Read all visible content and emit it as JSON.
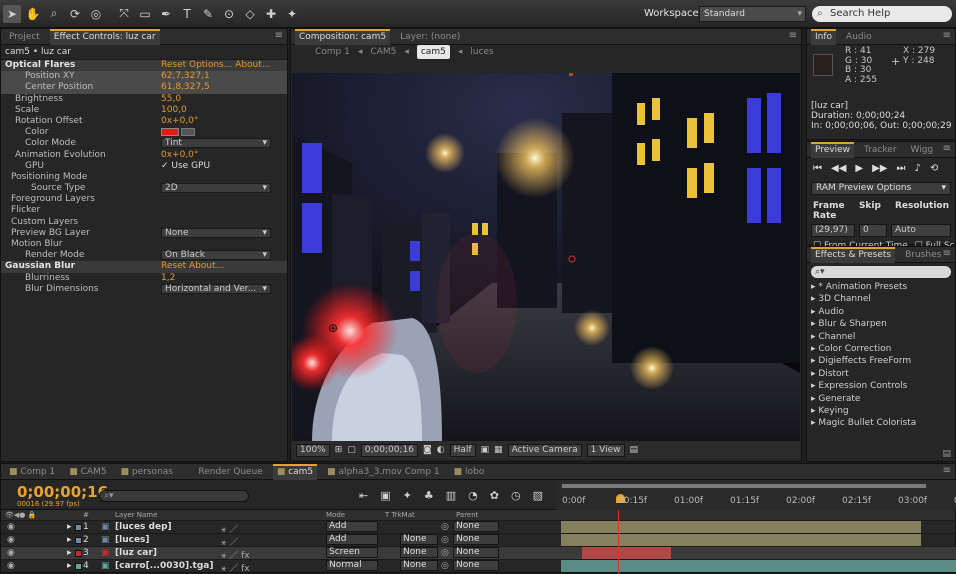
{
  "toolbar": {
    "tools": [
      "selection-tool",
      "hand-tool",
      "zoom-tool",
      "rotation-tool",
      "camera-tool",
      "pan-behind-tool",
      "mask-tool",
      "pen-tool",
      "text-tool",
      "brush-tool",
      "clone-stamp-tool",
      "eraser-tool",
      "roto-brush-tool",
      "puppet-tool"
    ],
    "workspace_label": "Workspace:",
    "workspace_value": "Standard",
    "search_placeholder": "Search Help"
  },
  "effect_controls": {
    "tab_project": "Project",
    "tab_effect": "Effect Controls: luz car",
    "breadcrumb": "cam5 • luz car",
    "rows": [
      {
        "label": "Optical Flares",
        "indent": 4,
        "type": "hdr",
        "val": "Reset  Options...  About..."
      },
      {
        "label": "Position XY",
        "indent": 24,
        "type": "sel",
        "val": "62,7,327,1"
      },
      {
        "label": "Center Position",
        "indent": 24,
        "type": "sel",
        "val": "61,8,327,5"
      },
      {
        "label": "Brightness",
        "indent": 14,
        "val": "55,0"
      },
      {
        "label": "Scale",
        "indent": 14,
        "val": "100,0"
      },
      {
        "label": "Rotation Offset",
        "indent": 14,
        "val": "0x+0,0°"
      },
      {
        "label": "Color",
        "indent": 24,
        "type": "color"
      },
      {
        "label": "Color Mode",
        "indent": 24,
        "type": "select",
        "val": "Tint"
      },
      {
        "label": "Animation Evolution",
        "indent": 14,
        "val": "0x+0,0°"
      },
      {
        "label": "GPU",
        "indent": 24,
        "type": "check",
        "val": "✓ Use GPU"
      },
      {
        "label": "Positioning Mode",
        "indent": 10,
        "type": "group"
      },
      {
        "label": "Source Type",
        "indent": 30,
        "type": "select",
        "val": "2D"
      },
      {
        "label": "Foreground Layers",
        "indent": 10
      },
      {
        "label": "Flicker",
        "indent": 10
      },
      {
        "label": "Custom Layers",
        "indent": 10
      },
      {
        "label": "Preview BG Layer",
        "indent": 10,
        "type": "select",
        "val": "None"
      },
      {
        "label": "Motion Blur",
        "indent": 10
      },
      {
        "label": "Render Mode",
        "indent": 24,
        "type": "select",
        "val": "On Black"
      },
      {
        "label": "Gaussian Blur",
        "indent": 4,
        "type": "hdr2",
        "val": "Reset                About..."
      },
      {
        "label": "Blurriness",
        "indent": 24,
        "val": "1,2"
      },
      {
        "label": "Blur Dimensions",
        "indent": 24,
        "type": "select",
        "val": "Horizontal and Ver..."
      }
    ]
  },
  "composition": {
    "tab_comp": "Composition: cam5",
    "tab_layer": "Layer: (none)",
    "breadcrumbs": [
      "Comp 1",
      "CAM5",
      "cam5",
      "luces"
    ],
    "zoom": "100%",
    "timecode": "0;00;00;16",
    "resolution": "Half",
    "camera": "Active Camera",
    "views": "1 View"
  },
  "info": {
    "tab_info": "Info",
    "tab_audio": "Audio",
    "r": "R : 41",
    "g": "G : 30",
    "b": "B : 30",
    "a": "A : 255",
    "x": "X : 279",
    "y": "Y : 248",
    "layer": "[luz car]",
    "duration": "Duration: 0;00;00;24",
    "inout": "In: 0;00;00;06, Out: 0;00;00;29",
    "swatch_color": "#291e1e"
  },
  "preview": {
    "tab_preview": "Preview",
    "tab_tracker": "Tracker",
    "tab_wiggler": "Wigg",
    "ram_options": "RAM Preview Options",
    "frame_rate_label": "Frame Rate",
    "skip_label": "Skip",
    "resolution_label": "Resolution",
    "frame_rate": "(29,97)",
    "skip": "0",
    "resolution": "Auto",
    "from_current": "From Current Time",
    "full_screen": "Full Scre"
  },
  "effects_presets": {
    "tab_fx": "Effects & Presets",
    "tab_brushes": "Brushes",
    "items": [
      "* Animation Presets",
      "3D Channel",
      "Audio",
      "Blur & Sharpen",
      "Channel",
      "Color Correction",
      "Digieffects FreeForm",
      "Distort",
      "Expression Controls",
      "Generate",
      "Keying",
      "Magic Bullet Colorista"
    ]
  },
  "timeline": {
    "tabs": [
      "Comp 1",
      "CAM5",
      "personas",
      "Render Queue",
      "cam5",
      "alpha3_3.mov Comp 1",
      "lobo"
    ],
    "tab_colors": [
      "#8a8a8a",
      "#8a8a8a",
      "#8a8a8a",
      "",
      "#8a8a8a",
      "#8a8a8a",
      "#8a8a8a"
    ],
    "timecode": "0;00;00;16",
    "fps": "00016 (29.97 fps)",
    "ruler": [
      "0:00f",
      "00:15f",
      "01:00f",
      "01:15f",
      "02:00f",
      "02:15f",
      "03:00f",
      "03:1"
    ],
    "columns": {
      "layer_name": "Layer Name",
      "mode": "Mode",
      "trkmat": "T TrkMat",
      "parent": "Parent"
    },
    "layers": [
      {
        "num": "1",
        "name": "[luces dep]",
        "mode": "Add",
        "trkmat": "",
        "parent": "None",
        "color": "#6f8a9e",
        "bar_color": "#86805e"
      },
      {
        "num": "2",
        "name": "[luces]",
        "mode": "Add",
        "trkmat": "None",
        "parent": "None",
        "color": "#6f8a9e",
        "bar_color": "#86805e"
      },
      {
        "num": "3",
        "name": "[luz car]",
        "mode": "Screen",
        "trkmat": "None",
        "parent": "None",
        "color": "#c03030",
        "bar_color": "#b04848"
      },
      {
        "num": "4",
        "name": "[carro[...0030].tga]",
        "mode": "Normal",
        "trkmat": "None",
        "parent": "None",
        "color": "#5fa8a0",
        "bar_color": "#5a8c86"
      }
    ]
  }
}
